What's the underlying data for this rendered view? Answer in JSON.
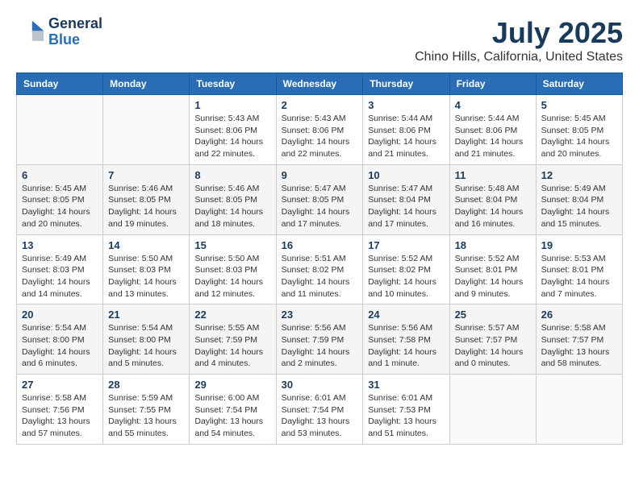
{
  "logo": {
    "line1": "General",
    "line2": "Blue"
  },
  "title": "July 2025",
  "location": "Chino Hills, California, United States",
  "weekdays": [
    "Sunday",
    "Monday",
    "Tuesday",
    "Wednesday",
    "Thursday",
    "Friday",
    "Saturday"
  ],
  "weeks": [
    [
      {
        "day": "",
        "info": ""
      },
      {
        "day": "",
        "info": ""
      },
      {
        "day": "1",
        "info": "Sunrise: 5:43 AM\nSunset: 8:06 PM\nDaylight: 14 hours and 22 minutes."
      },
      {
        "day": "2",
        "info": "Sunrise: 5:43 AM\nSunset: 8:06 PM\nDaylight: 14 hours and 22 minutes."
      },
      {
        "day": "3",
        "info": "Sunrise: 5:44 AM\nSunset: 8:06 PM\nDaylight: 14 hours and 21 minutes."
      },
      {
        "day": "4",
        "info": "Sunrise: 5:44 AM\nSunset: 8:06 PM\nDaylight: 14 hours and 21 minutes."
      },
      {
        "day": "5",
        "info": "Sunrise: 5:45 AM\nSunset: 8:05 PM\nDaylight: 14 hours and 20 minutes."
      }
    ],
    [
      {
        "day": "6",
        "info": "Sunrise: 5:45 AM\nSunset: 8:05 PM\nDaylight: 14 hours and 20 minutes."
      },
      {
        "day": "7",
        "info": "Sunrise: 5:46 AM\nSunset: 8:05 PM\nDaylight: 14 hours and 19 minutes."
      },
      {
        "day": "8",
        "info": "Sunrise: 5:46 AM\nSunset: 8:05 PM\nDaylight: 14 hours and 18 minutes."
      },
      {
        "day": "9",
        "info": "Sunrise: 5:47 AM\nSunset: 8:05 PM\nDaylight: 14 hours and 17 minutes."
      },
      {
        "day": "10",
        "info": "Sunrise: 5:47 AM\nSunset: 8:04 PM\nDaylight: 14 hours and 17 minutes."
      },
      {
        "day": "11",
        "info": "Sunrise: 5:48 AM\nSunset: 8:04 PM\nDaylight: 14 hours and 16 minutes."
      },
      {
        "day": "12",
        "info": "Sunrise: 5:49 AM\nSunset: 8:04 PM\nDaylight: 14 hours and 15 minutes."
      }
    ],
    [
      {
        "day": "13",
        "info": "Sunrise: 5:49 AM\nSunset: 8:03 PM\nDaylight: 14 hours and 14 minutes."
      },
      {
        "day": "14",
        "info": "Sunrise: 5:50 AM\nSunset: 8:03 PM\nDaylight: 14 hours and 13 minutes."
      },
      {
        "day": "15",
        "info": "Sunrise: 5:50 AM\nSunset: 8:03 PM\nDaylight: 14 hours and 12 minutes."
      },
      {
        "day": "16",
        "info": "Sunrise: 5:51 AM\nSunset: 8:02 PM\nDaylight: 14 hours and 11 minutes."
      },
      {
        "day": "17",
        "info": "Sunrise: 5:52 AM\nSunset: 8:02 PM\nDaylight: 14 hours and 10 minutes."
      },
      {
        "day": "18",
        "info": "Sunrise: 5:52 AM\nSunset: 8:01 PM\nDaylight: 14 hours and 9 minutes."
      },
      {
        "day": "19",
        "info": "Sunrise: 5:53 AM\nSunset: 8:01 PM\nDaylight: 14 hours and 7 minutes."
      }
    ],
    [
      {
        "day": "20",
        "info": "Sunrise: 5:54 AM\nSunset: 8:00 PM\nDaylight: 14 hours and 6 minutes."
      },
      {
        "day": "21",
        "info": "Sunrise: 5:54 AM\nSunset: 8:00 PM\nDaylight: 14 hours and 5 minutes."
      },
      {
        "day": "22",
        "info": "Sunrise: 5:55 AM\nSunset: 7:59 PM\nDaylight: 14 hours and 4 minutes."
      },
      {
        "day": "23",
        "info": "Sunrise: 5:56 AM\nSunset: 7:59 PM\nDaylight: 14 hours and 2 minutes."
      },
      {
        "day": "24",
        "info": "Sunrise: 5:56 AM\nSunset: 7:58 PM\nDaylight: 14 hours and 1 minute."
      },
      {
        "day": "25",
        "info": "Sunrise: 5:57 AM\nSunset: 7:57 PM\nDaylight: 14 hours and 0 minutes."
      },
      {
        "day": "26",
        "info": "Sunrise: 5:58 AM\nSunset: 7:57 PM\nDaylight: 13 hours and 58 minutes."
      }
    ],
    [
      {
        "day": "27",
        "info": "Sunrise: 5:58 AM\nSunset: 7:56 PM\nDaylight: 13 hours and 57 minutes."
      },
      {
        "day": "28",
        "info": "Sunrise: 5:59 AM\nSunset: 7:55 PM\nDaylight: 13 hours and 55 minutes."
      },
      {
        "day": "29",
        "info": "Sunrise: 6:00 AM\nSunset: 7:54 PM\nDaylight: 13 hours and 54 minutes."
      },
      {
        "day": "30",
        "info": "Sunrise: 6:01 AM\nSunset: 7:54 PM\nDaylight: 13 hours and 53 minutes."
      },
      {
        "day": "31",
        "info": "Sunrise: 6:01 AM\nSunset: 7:53 PM\nDaylight: 13 hours and 51 minutes."
      },
      {
        "day": "",
        "info": ""
      },
      {
        "day": "",
        "info": ""
      }
    ]
  ]
}
